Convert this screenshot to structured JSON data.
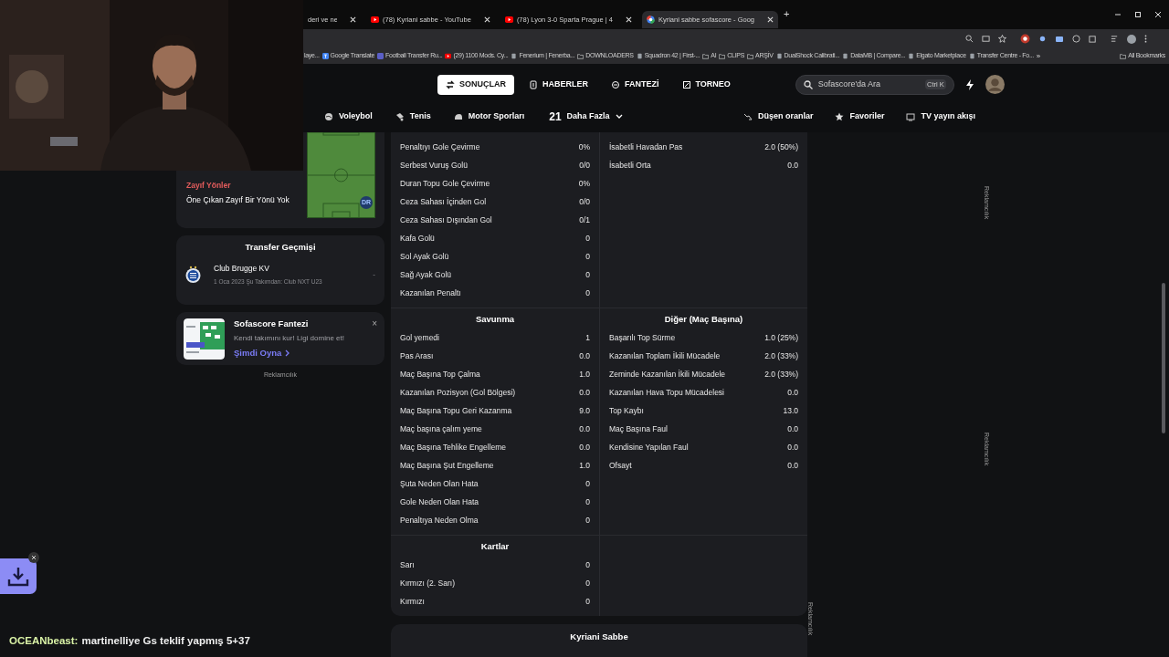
{
  "browser": {
    "tabs": [
      {
        "title": "deri ve ne",
        "kind": "plain",
        "selected": false
      },
      {
        "title": "(78) Kyriani sabbe - YouTube",
        "kind": "video",
        "selected": false
      },
      {
        "title": "(78) Lyon 3-0 Sparta Prague | 4",
        "kind": "video",
        "selected": false
      },
      {
        "title": "Kyriani sabbe sofascore - Goog",
        "kind": "search",
        "selected": true
      }
    ],
    "new_tab": "+",
    "bookmarks": [
      {
        "label": "laye...",
        "kind": "page"
      },
      {
        "label": "Google Translate",
        "kind": "translate"
      },
      {
        "label": "Football Transfer Ru...",
        "kind": "tf"
      },
      {
        "label": "(29) 1100 Mods. Cy...",
        "kind": "video"
      },
      {
        "label": "Fenerium | Fenerba...",
        "kind": "page"
      },
      {
        "label": "DOWNLOADERS",
        "kind": "folder"
      },
      {
        "label": "Squadron 42 | First-...",
        "kind": "page"
      },
      {
        "label": "AI",
        "kind": "folder"
      },
      {
        "label": "CLIPS",
        "kind": "folder"
      },
      {
        "label": "ARŞİV",
        "kind": "folder"
      },
      {
        "label": "DualShock Calibrati...",
        "kind": "page"
      },
      {
        "label": "DataMB | Compare...",
        "kind": "page"
      },
      {
        "label": "Elgato Marketplace",
        "kind": "page"
      },
      {
        "label": "Transfer Centre - Fo...",
        "kind": "page"
      },
      {
        "label": "»",
        "kind": "more"
      },
      {
        "label": "All Bookmarks",
        "kind": "folder"
      }
    ]
  },
  "nav": {
    "items": [
      {
        "label": "SONUÇLAR",
        "selected": true
      },
      {
        "label": "HABERLER",
        "selected": false
      },
      {
        "label": "FANTEZİ",
        "selected": false
      },
      {
        "label": "TORNEO",
        "selected": false
      }
    ],
    "search": {
      "placeholder": "Sofascore'da Ara",
      "shortcut": "Ctrl K"
    }
  },
  "sports": [
    "Voleybol",
    "Tenis",
    "Motor Sporları"
  ],
  "more": {
    "count": "21",
    "label": "Daha Fazla"
  },
  "links": [
    "Düşen oranlar",
    "Favoriler",
    "TV yayın akışı"
  ],
  "weaknesses": {
    "title": "Zayıf Yönler",
    "text": "Öne Çıkan Zayıf Bir Yönü Yok",
    "position": "DR"
  },
  "transfers": {
    "title": "Transfer Geçmişi",
    "items": [
      {
        "club": "Club Brugge KV",
        "detail": "1 Oca 2023 Şu Takımdan: Club NXT U23",
        "fee": "-"
      }
    ]
  },
  "promo": {
    "title": "Sofascore Fantezi",
    "text": "Kendi takımını kur! Ligi domine et!",
    "link": "Şimdi Oyna",
    "close": "×"
  },
  "ad_label": "Reklamcılık",
  "stats": {
    "sections": [
      {
        "left": {
          "rows": [
            [
              "Penaltıyı Gole Çevirme",
              "0%"
            ],
            [
              "Serbest Vuruş Golü",
              "0/0"
            ],
            [
              "Duran Topu Gole Çevirme",
              "0%"
            ],
            [
              "Ceza Sahası İçinden Gol",
              "0/0"
            ],
            [
              "Ceza Sahası Dışından Gol",
              "0/1"
            ],
            [
              "Kafa Golü",
              "0"
            ],
            [
              "Sol Ayak Golü",
              "0"
            ],
            [
              "Sağ Ayak Golü",
              "0"
            ],
            [
              "Kazanılan Penaltı",
              "0"
            ]
          ]
        },
        "right": {
          "rows": [
            [
              "İsabetli Havadan Pas",
              "2.0 (50%)"
            ],
            [
              "İsabetli Orta",
              "0.0"
            ]
          ]
        }
      },
      {
        "left": {
          "title": "Savunma",
          "rows": [
            [
              "Gol yemedi",
              "1"
            ],
            [
              "Pas Arası",
              "0.0"
            ],
            [
              "Maç Başına Top Çalma",
              "1.0"
            ],
            [
              "Kazanılan Pozisyon (Gol Bölgesi)",
              "0.0"
            ],
            [
              "Maç Başına Topu Geri Kazanma",
              "9.0"
            ],
            [
              "Maç başına çalım yeme",
              "0.0"
            ],
            [
              "Maç Başına Tehlike Engelleme",
              "0.0"
            ],
            [
              "Maç Başına Şut Engelleme",
              "1.0"
            ],
            [
              "Şuta Neden Olan Hata",
              "0"
            ],
            [
              "Gole Neden Olan Hata",
              "0"
            ],
            [
              "Penaltıya Neden Olma",
              "0"
            ]
          ]
        },
        "right": {
          "title": "Diğer (Maç Başına)",
          "rows": [
            [
              "Başarılı Top Sürme",
              "1.0 (25%)"
            ],
            [
              "Kazanılan Toplam İkili Mücadele",
              "2.0 (33%)"
            ],
            [
              "Zeminde Kazanılan İkili Mücadele",
              "2.0 (33%)"
            ],
            [
              "Kazanılan Hava Topu Mücadelesi",
              "0.0"
            ],
            [
              "Top Kaybı",
              "13.0"
            ],
            [
              "Maç Başına Faul",
              "0.0"
            ],
            [
              "Kendisine Yapılan Faul",
              "0.0"
            ],
            [
              "Ofsayt",
              "0.0"
            ]
          ]
        }
      },
      {
        "left": {
          "title": "Kartlar",
          "rows": [
            [
              "Sarı",
              "0"
            ],
            [
              "Kırmızı (2. Sarı)",
              "0"
            ],
            [
              "Kırmızı",
              "0"
            ]
          ]
        }
      }
    ]
  },
  "next_card": {
    "title": "Kyriani Sabbe"
  },
  "side_ad_labels": [
    "Reklamcılık",
    "Reklamcılık",
    "Reklamcılık"
  ],
  "webcam": {
    "kind": "picture"
  },
  "chat": {
    "user": "OCEANbeast:",
    "message": "martinelliye Gs teklif yapmış 5+37"
  }
}
